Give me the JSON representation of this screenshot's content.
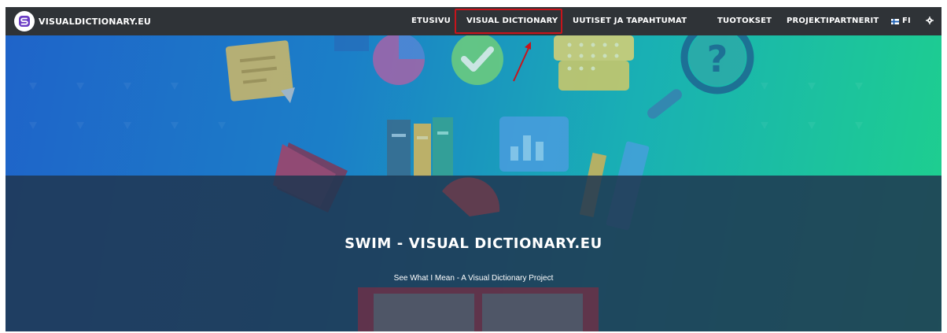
{
  "brand": {
    "name": "VISUALDICTIONARY.EU"
  },
  "nav": {
    "items": [
      {
        "label": "ETUSIVU"
      },
      {
        "label": "VISUAL DICTIONARY"
      },
      {
        "label": "UUTISET JA TAPAHTUMAT"
      },
      {
        "label": "TUOTOKSET"
      },
      {
        "label": "PROJEKTIPARTNERIT"
      }
    ],
    "language": "FI"
  },
  "hero": {
    "title": "SWIM - VISUAL DICTIONARY.EU",
    "subtitle": "See What I Mean - A Visual Dictionary Project"
  },
  "colors": {
    "navbar": "#2f3337",
    "highlight": "#c8141b",
    "brand_logo": "#6a3cc4"
  },
  "icons": [
    "logo-icon",
    "flag-icon",
    "gear-icon"
  ]
}
